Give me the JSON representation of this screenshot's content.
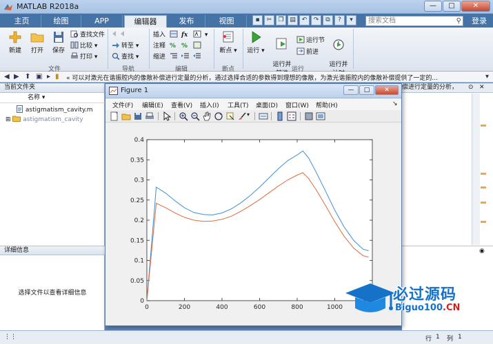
{
  "window": {
    "title": "MATLAB R2018a",
    "minimize": "—",
    "maximize": "□",
    "close": "✕"
  },
  "tabs": [
    {
      "label": "主页"
    },
    {
      "label": "绘图"
    },
    {
      "label": "APP"
    },
    {
      "label": "编辑器"
    },
    {
      "label": "发布"
    },
    {
      "label": "视图"
    }
  ],
  "search": {
    "placeholder": "搜索文档"
  },
  "login": "登录",
  "ribbon": {
    "file": {
      "new": "新建",
      "open": "打开",
      "save": "保存",
      "find_files": "查找文件",
      "compare": "比较",
      "print": "打印",
      "label": "文件"
    },
    "navigate": {
      "goto": "转至",
      "find": "查找",
      "label": "导航"
    },
    "edit": {
      "insert": "插入",
      "comment": "注释",
      "indent": "缩进",
      "fx": "fx",
      "label": "编辑"
    },
    "breakpoints": {
      "breakpoints": "断点",
      "label": "断点"
    },
    "run": {
      "run": "运行",
      "run_advance": "运行并\n前进",
      "run_section": "运行节",
      "advance": "前进",
      "run_time": "运行并\n计时",
      "label": "运行"
    }
  },
  "pathbar": {
    "path": "« 可以对激光在谐振腔内的像散补偿进行定量的分析，通过选择合适的参数得到理想的像散，为激光谐振腔内的像散补偿提供了一定的..."
  },
  "left_panel": {
    "header": "当前文件夹",
    "column": "名称 ▾",
    "files": [
      {
        "name": "astigmatism_cavity.m"
      },
      {
        "name": "astigmatism_cavity"
      }
    ],
    "details_header": "详细信息",
    "details_message": "选择文件以查看详细信息"
  },
  "right_panel": {
    "header_text": "偿进行定量的分析，"
  },
  "status": {
    "row_label": "行",
    "row_value": "1",
    "col_label": "列",
    "col_value": "1"
  },
  "figure": {
    "title": "Figure 1",
    "menu": [
      {
        "label": "文件(F)"
      },
      {
        "label": "编辑(E)"
      },
      {
        "label": "查看(V)"
      },
      {
        "label": "插入(I)"
      },
      {
        "label": "工具(T)"
      },
      {
        "label": "桌面(D)"
      },
      {
        "label": "窗口(W)"
      },
      {
        "label": "帮助(H)"
      }
    ]
  },
  "colors": {
    "series1": "#3d8fd6",
    "series2": "#e06b3a",
    "accent": "#4673a6"
  },
  "chart_data": {
    "type": "line",
    "title": "",
    "xlabel": "",
    "ylabel": "",
    "xlim": [
      0,
      1200
    ],
    "ylim": [
      0,
      0.4
    ],
    "xticks": [
      0,
      200,
      400,
      600,
      800,
      1000
    ],
    "yticks": [
      0,
      0.05,
      0.1,
      0.15,
      0.2,
      0.25,
      0.3,
      0.35,
      0.4
    ],
    "grid": false,
    "series": [
      {
        "color": "#3d8fd6",
        "x": [
          0,
          50,
          100,
          150,
          200,
          250,
          300,
          350,
          400,
          450,
          500,
          550,
          600,
          650,
          700,
          750,
          800,
          830,
          860,
          900,
          950,
          1000,
          1050,
          1100,
          1150,
          1180
        ],
        "y": [
          0.0,
          0.282,
          0.267,
          0.248,
          0.231,
          0.219,
          0.214,
          0.213,
          0.218,
          0.228,
          0.243,
          0.261,
          0.282,
          0.305,
          0.328,
          0.348,
          0.362,
          0.372,
          0.355,
          0.32,
          0.273,
          0.225,
          0.183,
          0.15,
          0.128,
          0.124
        ]
      },
      {
        "color": "#e06b3a",
        "x": [
          0,
          50,
          100,
          150,
          200,
          250,
          300,
          350,
          400,
          450,
          500,
          550,
          600,
          650,
          700,
          750,
          800,
          830,
          860,
          900,
          950,
          1000,
          1050,
          1100,
          1150,
          1180
        ],
        "y": [
          0.0,
          0.242,
          0.231,
          0.218,
          0.207,
          0.2,
          0.197,
          0.198,
          0.202,
          0.21,
          0.222,
          0.236,
          0.251,
          0.268,
          0.285,
          0.3,
          0.312,
          0.318,
          0.304,
          0.276,
          0.237,
          0.196,
          0.16,
          0.131,
          0.112,
          0.108
        ]
      }
    ]
  }
}
